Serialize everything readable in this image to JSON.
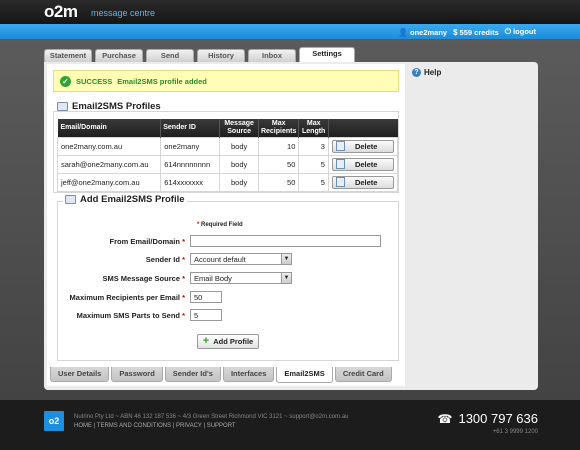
{
  "header": {
    "logo": "o2m",
    "subtitle": "message centre",
    "user": "one2many",
    "credits": "559 credits",
    "logout": "logout"
  },
  "tabs": [
    "Statement",
    "Purchase",
    "Send",
    "History",
    "Inbox",
    "Settings"
  ],
  "active_tab": "Settings",
  "alert": {
    "status": "SUCCESS",
    "message": "Email2SMS profile added"
  },
  "help": "Help",
  "profiles_section": {
    "title": "Email2SMS Profiles",
    "columns": [
      "Email/Domain",
      "Sender ID",
      "Message Source",
      "Max Recipients",
      "Max Length",
      ""
    ],
    "rows": [
      {
        "email": "one2many.com.au",
        "sender": "one2many",
        "source": "body",
        "max_recipients": "10",
        "max_length": "3",
        "action": "Delete"
      },
      {
        "email": "sarah@one2many.com.au",
        "sender": "614nnnnnnnn",
        "source": "body",
        "max_recipients": "50",
        "max_length": "5",
        "action": "Delete"
      },
      {
        "email": "jeff@one2many.com.au",
        "sender": "614xxxxxxx",
        "source": "body",
        "max_recipients": "50",
        "max_length": "5",
        "action": "Delete"
      }
    ]
  },
  "add_section": {
    "title": "Add Email2SMS Profile",
    "required_note": "Required Field",
    "fields": {
      "from_label": "From Email/Domain",
      "from_value": "",
      "sender_label": "Sender Id",
      "sender_value": "Account default",
      "source_label": "SMS Message Source",
      "source_value": "Email Body",
      "max_recipients_label": "Maximum Recipients per Email",
      "max_recipients_value": "50",
      "max_parts_label": "Maximum SMS Parts to Send",
      "max_parts_value": "5"
    },
    "button": "Add Profile"
  },
  "subtabs": [
    "User Details",
    "Password",
    "Sender Id's",
    "Interfaces",
    "Email2SMS",
    "Credit Card"
  ],
  "active_subtab": "Email2SMS",
  "footer": {
    "logo": "o2",
    "company": "Nutrino Pty Ltd ~ ABN 46 132 187 536 ~ 4/3 Green Street Richmond VIC 3121 ~ support@o2m.com.au",
    "links": "HOME | TERMS AND CONDITIONS | PRIVACY | SUPPORT",
    "phone": "1300 797 636",
    "phone_intl": "+61 3 9999 1200"
  },
  "colors": {
    "accent": "#1c8bd9",
    "success": "#2f8a2f",
    "alert_bg": "#fffdb6",
    "required": "#cc0000"
  }
}
